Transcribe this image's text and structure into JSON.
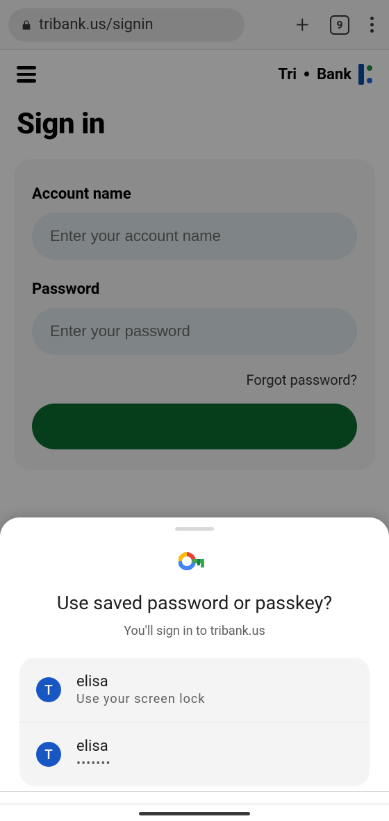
{
  "browser": {
    "url": "tribank.us/signin",
    "tab_count": "9"
  },
  "page": {
    "brand_left": "Tri",
    "brand_right": "Bank",
    "heading": "Sign in",
    "account_label": "Account name",
    "account_placeholder": "Enter your account name",
    "password_label": "Password",
    "password_placeholder": "Enter your password",
    "forgot": "Forgot password?"
  },
  "sheet": {
    "title": "Use saved password or passkey?",
    "subtitle": "You'll sign in to tribank.us",
    "credentials": [
      {
        "avatar": "T",
        "name": "elisa",
        "sub": "Use your screen lock"
      },
      {
        "avatar": "T",
        "name": "elisa",
        "sub": "•••••••"
      }
    ]
  }
}
